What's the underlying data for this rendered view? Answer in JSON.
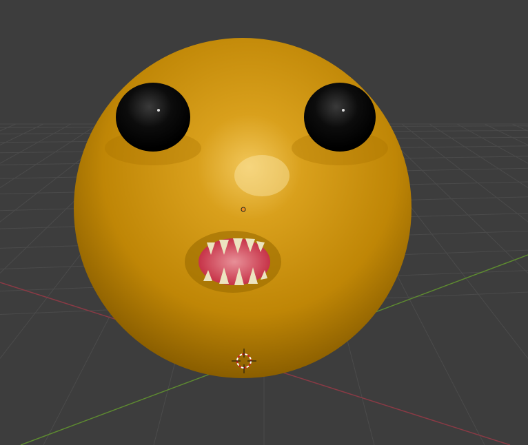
{
  "viewport": {
    "background_color": "#3d3d3d",
    "grid_color": "#4a4a4a",
    "x_axis_color": "#8a3a45",
    "y_axis_color": "#5a8a2e"
  },
  "object": {
    "name_icon": "sphere-face-model",
    "body_color": "#c8900c",
    "eye_color": "#050505",
    "mouth_color": "#d0384a",
    "teeth_color": "#e8e0b8",
    "origin_color": "#f09020"
  },
  "cursor": {
    "icon": "3d-cursor-icon"
  }
}
